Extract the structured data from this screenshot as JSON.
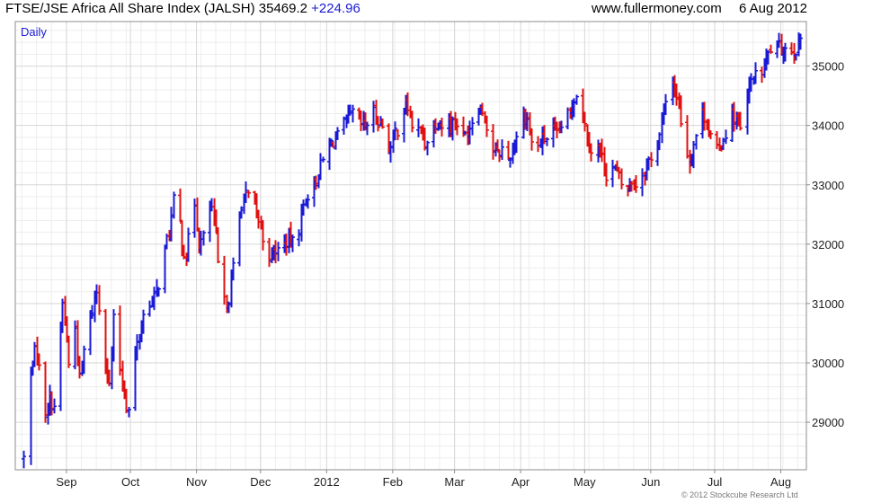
{
  "header": {
    "title": "FTSE/JSE Africa All Share Index (JALSH) 35469.2",
    "change": "+224.96",
    "site": "www.fullermoney.com",
    "date": "6 Aug 2012"
  },
  "footer": {
    "copyright": "© 2012 Stockcube Research Ltd"
  },
  "colors": {
    "up": "#1a1ad6",
    "down": "#e01010",
    "grid": "#d6d6d6",
    "frame": "#8c8c8c",
    "label": "#1a1ad6"
  },
  "chart_data": {
    "type": "ohlc",
    "title": "FTSE/JSE Africa All Share Index (JALSH)",
    "period_label": "Daily",
    "x_range": [
      "2012-08-06 -> 2011-08-01",
      "2012-08-06"
    ],
    "ylim": [
      28200,
      35750
    ],
    "y_ticks": [
      29000,
      30000,
      31000,
      32000,
      33000,
      34000,
      35000
    ],
    "x_ticks": [
      {
        "label": "Sep",
        "day": 24
      },
      {
        "label": "Oct",
        "day": 54
      },
      {
        "label": "Nov",
        "day": 85
      },
      {
        "label": "Dec",
        "day": 115
      },
      {
        "label": "2012",
        "day": 146
      },
      {
        "label": "Feb",
        "day": 177
      },
      {
        "label": "Mar",
        "day": 206
      },
      {
        "label": "Apr",
        "day": 237
      },
      {
        "label": "May",
        "day": 267
      },
      {
        "label": "Jun",
        "day": 298
      },
      {
        "label": "Jul",
        "day": 328
      },
      {
        "label": "Aug",
        "day": 359
      }
    ],
    "anchors": [
      [
        4,
        28400
      ],
      [
        6,
        29400
      ],
      [
        8,
        30100
      ],
      [
        10,
        30200
      ],
      [
        12,
        29600
      ],
      [
        14,
        29200
      ],
      [
        16,
        29400
      ],
      [
        18,
        29300
      ],
      [
        20,
        30100
      ],
      [
        22,
        31000
      ],
      [
        24,
        30400
      ],
      [
        26,
        29500
      ],
      [
        28,
        30600
      ],
      [
        30,
        29700
      ],
      [
        32,
        30200
      ],
      [
        34,
        30600
      ],
      [
        36,
        30900
      ],
      [
        38,
        31200
      ],
      [
        40,
        30700
      ],
      [
        42,
        30100
      ],
      [
        44,
        29600
      ],
      [
        46,
        30700
      ],
      [
        48,
        30100
      ],
      [
        50,
        29700
      ],
      [
        52,
        29300
      ],
      [
        54,
        29100
      ],
      [
        56,
        30100
      ],
      [
        58,
        30500
      ],
      [
        60,
        30800
      ],
      [
        62,
        31100
      ],
      [
        64,
        31000
      ],
      [
        66,
        31200
      ],
      [
        68,
        31500
      ],
      [
        70,
        31900
      ],
      [
        72,
        32200
      ],
      [
        74,
        32700
      ],
      [
        76,
        32700
      ],
      [
        78,
        32000
      ],
      [
        80,
        31800
      ],
      [
        82,
        32300
      ],
      [
        84,
        32700
      ],
      [
        86,
        32000
      ],
      [
        88,
        32100
      ],
      [
        90,
        32600
      ],
      [
        92,
        32600
      ],
      [
        94,
        32100
      ],
      [
        96,
        31200
      ],
      [
        98,
        31000
      ],
      [
        100,
        31100
      ],
      [
        102,
        31600
      ],
      [
        104,
        32300
      ],
      [
        106,
        32700
      ],
      [
        108,
        32800
      ],
      [
        110,
        32800
      ],
      [
        112,
        32600
      ],
      [
        114,
        32400
      ],
      [
        116,
        32100
      ],
      [
        118,
        31900
      ],
      [
        120,
        31800
      ],
      [
        122,
        31900
      ],
      [
        124,
        31900
      ],
      [
        126,
        32000
      ],
      [
        128,
        32100
      ],
      [
        130,
        32000
      ],
      [
        132,
        32100
      ],
      [
        134,
        32500
      ],
      [
        136,
        32800
      ],
      [
        138,
        32900
      ],
      [
        140,
        33000
      ],
      [
        142,
        33200
      ],
      [
        144,
        33400
      ],
      [
        146,
        33600
      ],
      [
        148,
        33700
      ],
      [
        150,
        33800
      ],
      [
        152,
        33800
      ],
      [
        154,
        34000
      ],
      [
        156,
        34100
      ],
      [
        158,
        34200
      ],
      [
        160,
        34100
      ],
      [
        162,
        34000
      ],
      [
        164,
        34000
      ],
      [
        166,
        34100
      ],
      [
        168,
        34200
      ],
      [
        170,
        34100
      ],
      [
        172,
        34000
      ],
      [
        174,
        33700
      ],
      [
        176,
        33600
      ],
      [
        178,
        33900
      ],
      [
        180,
        34000
      ],
      [
        182,
        34300
      ],
      [
        184,
        34300
      ],
      [
        186,
        34000
      ],
      [
        188,
        33900
      ],
      [
        190,
        33900
      ],
      [
        192,
        33700
      ],
      [
        194,
        33900
      ],
      [
        196,
        34000
      ],
      [
        198,
        34100
      ],
      [
        200,
        34000
      ],
      [
        202,
        34200
      ],
      [
        204,
        34000
      ],
      [
        206,
        34100
      ],
      [
        208,
        34000
      ],
      [
        210,
        33800
      ],
      [
        212,
        33900
      ],
      [
        214,
        34100
      ],
      [
        216,
        34400
      ],
      [
        218,
        34300
      ],
      [
        220,
        34200
      ],
      [
        222,
        33700
      ],
      [
        224,
        33600
      ],
      [
        226,
        33500
      ],
      [
        228,
        33600
      ],
      [
        230,
        33400
      ],
      [
        232,
        33500
      ],
      [
        234,
        33700
      ],
      [
        236,
        34000
      ],
      [
        238,
        34200
      ],
      [
        240,
        34100
      ],
      [
        242,
        33700
      ],
      [
        244,
        33600
      ],
      [
        246,
        33700
      ],
      [
        248,
        33800
      ],
      [
        250,
        33800
      ],
      [
        252,
        33900
      ],
      [
        254,
        33800
      ],
      [
        256,
        34000
      ],
      [
        258,
        34100
      ],
      [
        260,
        34200
      ],
      [
        262,
        34500
      ],
      [
        264,
        34600
      ],
      [
        266,
        34200
      ],
      [
        268,
        33800
      ],
      [
        270,
        33600
      ],
      [
        272,
        33700
      ],
      [
        274,
        33600
      ],
      [
        276,
        33300
      ],
      [
        278,
        33100
      ],
      [
        280,
        33300
      ],
      [
        282,
        33200
      ],
      [
        284,
        33000
      ],
      [
        286,
        32900
      ],
      [
        288,
        33000
      ],
      [
        290,
        33100
      ],
      [
        292,
        32900
      ],
      [
        294,
        33200
      ],
      [
        296,
        33300
      ],
      [
        298,
        33500
      ],
      [
        300,
        33700
      ],
      [
        302,
        33800
      ],
      [
        304,
        34200
      ],
      [
        306,
        34600
      ],
      [
        308,
        34800
      ],
      [
        310,
        34500
      ],
      [
        312,
        34100
      ],
      [
        314,
        33700
      ],
      [
        316,
        33400
      ],
      [
        318,
        33700
      ],
      [
        320,
        34000
      ],
      [
        322,
        34200
      ],
      [
        324,
        34100
      ],
      [
        326,
        33800
      ],
      [
        328,
        33500
      ],
      [
        330,
        33600
      ],
      [
        332,
        33800
      ],
      [
        334,
        34000
      ],
      [
        336,
        34200
      ],
      [
        338,
        34100
      ],
      [
        340,
        33900
      ],
      [
        342,
        34300
      ],
      [
        344,
        34600
      ],
      [
        346,
        34900
      ],
      [
        348,
        34700
      ],
      [
        350,
        34900
      ],
      [
        352,
        35100
      ],
      [
        354,
        35300
      ]
    ]
  }
}
